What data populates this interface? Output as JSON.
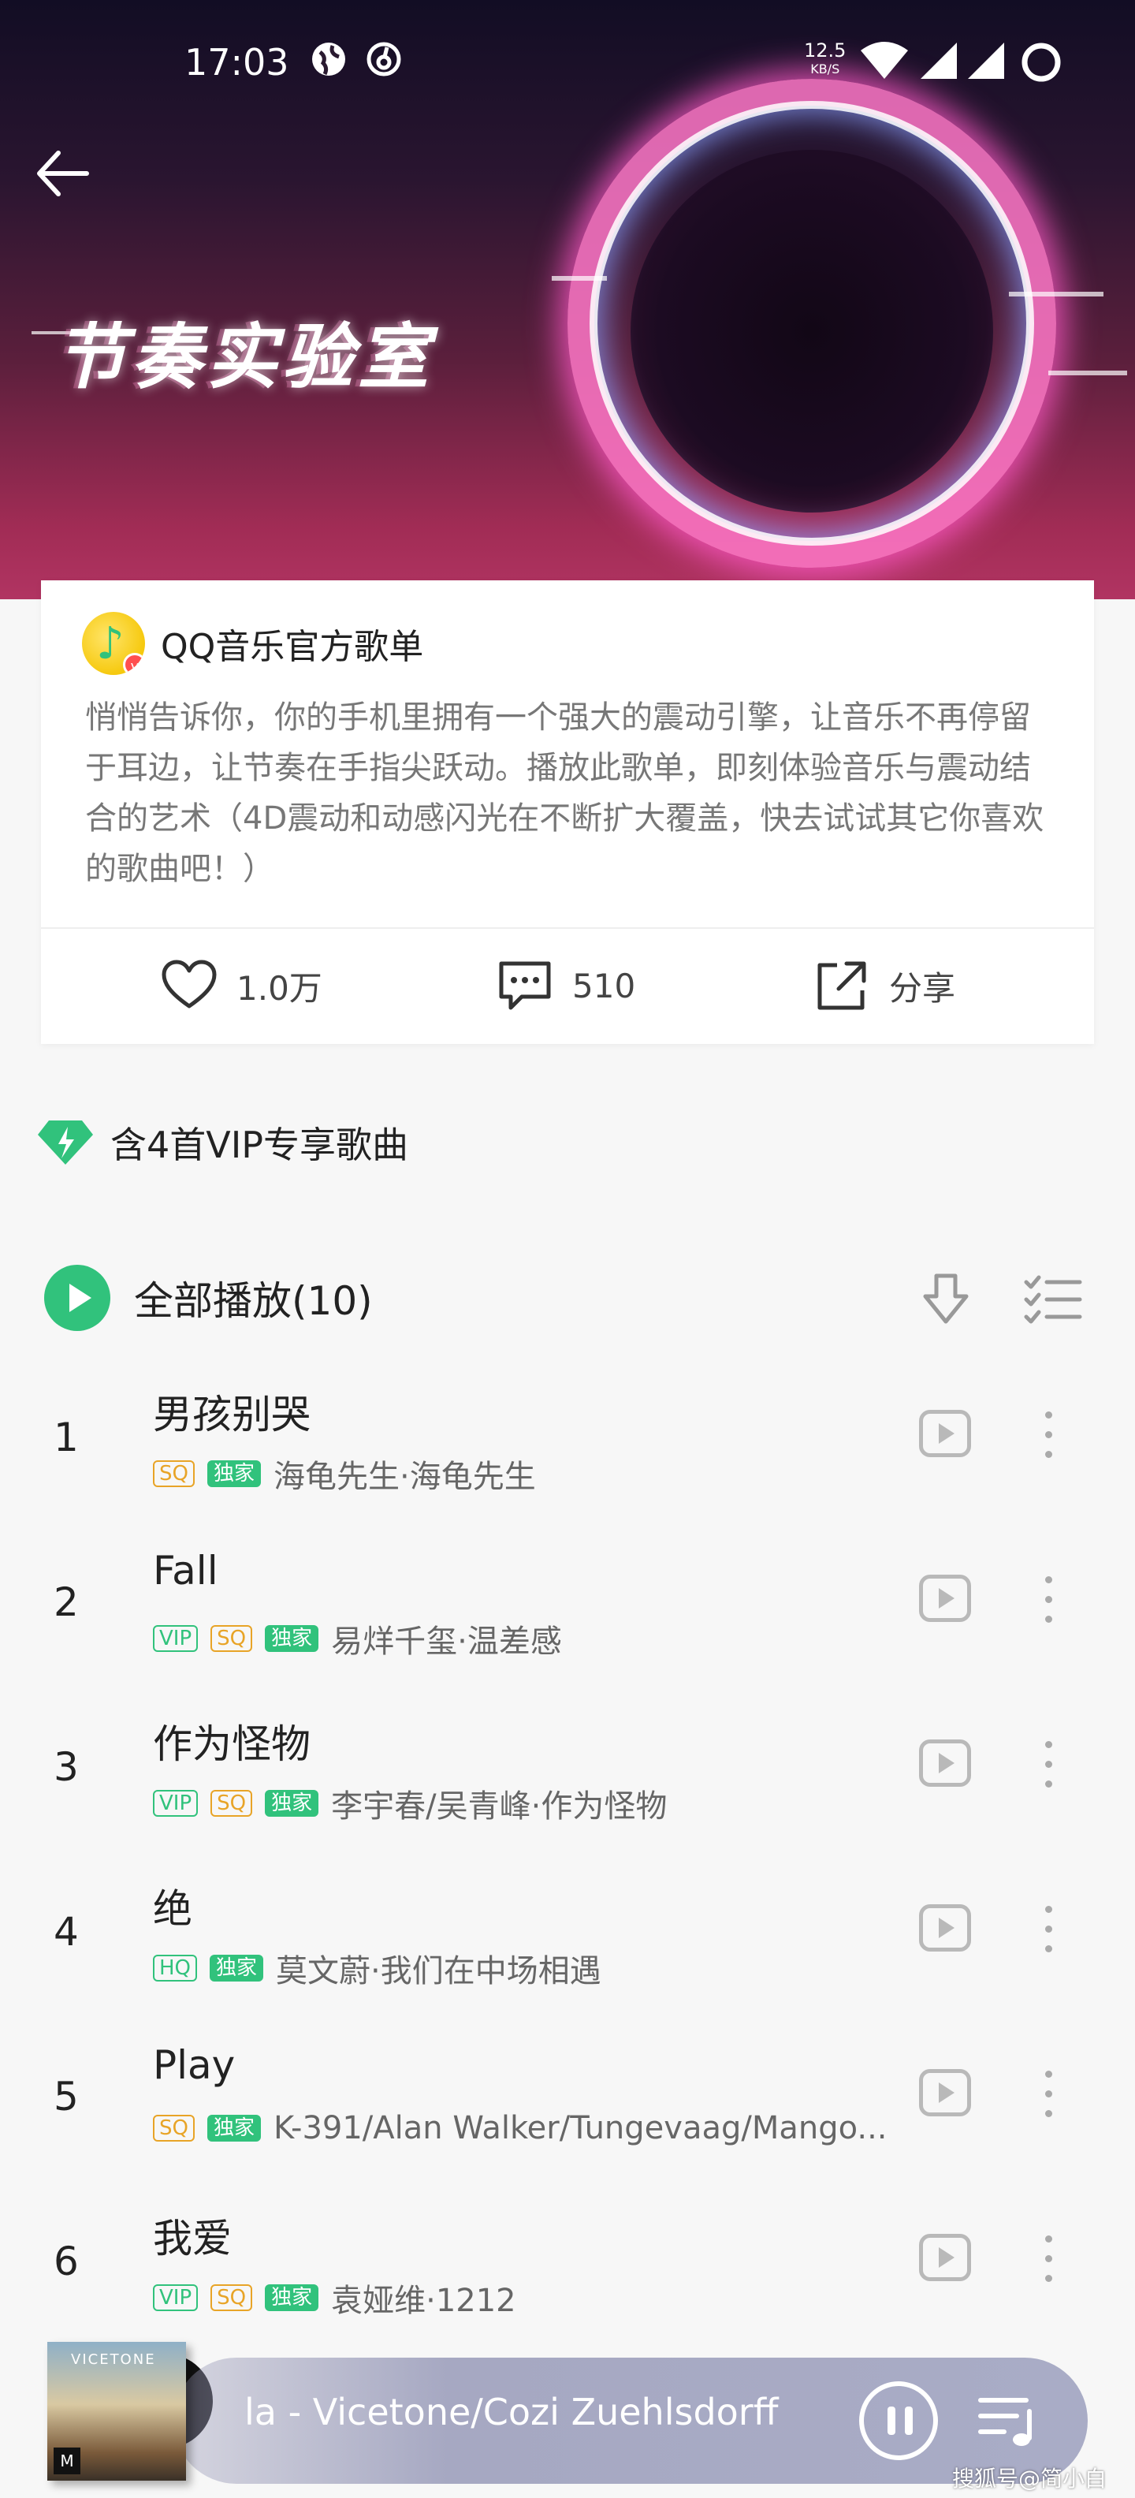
{
  "status_bar": {
    "time": "17:03",
    "net_speed": "12.5",
    "net_speed_unit": "KB/S"
  },
  "banner": {
    "title": "节奏实验室"
  },
  "playlist": {
    "creator": "QQ音乐官方歌单",
    "description": "悄悄告诉你，你的手机里拥有一个强大的震动引擎，让音乐不再停留于耳边，让节奏在手指尖跃动。播放此歌单，即刻体验音乐与震动结合的艺术（4D震动和动感闪光在不断扩大覆盖，快去试试其它你喜欢的歌曲吧！）",
    "likes": "1.0万",
    "comments": "510",
    "share_label": "分享"
  },
  "vip_notice": "含4首VIP专享歌曲",
  "play_all_label": "全部播放(10)",
  "songs": [
    {
      "num": "1",
      "title": "男孩别哭",
      "tags": [
        "SQ",
        "独家"
      ],
      "artist": "海龟先生·海龟先生"
    },
    {
      "num": "2",
      "title": "Fall",
      "tags": [
        "VIP",
        "SQ",
        "独家"
      ],
      "artist": "易烊千玺·温差感"
    },
    {
      "num": "3",
      "title": "作为怪物",
      "tags": [
        "VIP",
        "SQ",
        "独家"
      ],
      "artist": "李宇春/吴青峰·作为怪物"
    },
    {
      "num": "4",
      "title": "绝",
      "tags": [
        "HQ",
        "独家"
      ],
      "artist": "莫文蔚·我们在中场相遇"
    },
    {
      "num": "5",
      "title": "Play",
      "tags": [
        "SQ",
        "独家"
      ],
      "artist": "K-391/Alan Walker/Tungevaag/Mango..."
    },
    {
      "num": "6",
      "title": "我爱",
      "tags": [
        "VIP",
        "SQ",
        "独家"
      ],
      "artist": "袁娅维·1212"
    }
  ],
  "player": {
    "now_playing": "la - Vicetone/Cozi Zuehlsdorff",
    "cover_brand": "VICETONE"
  },
  "watermark": "搜狐号@简小白",
  "colors": {
    "accent_green": "#31c27c",
    "sq_orange": "#e8a427"
  }
}
